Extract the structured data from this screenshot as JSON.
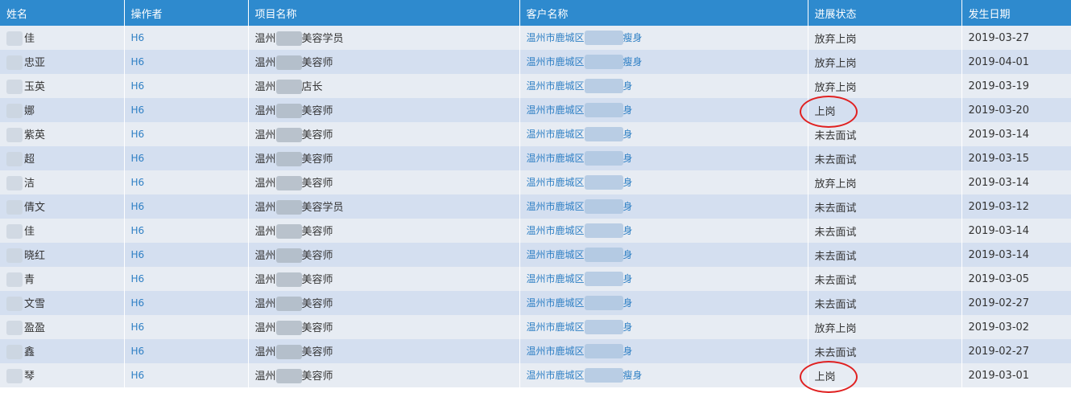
{
  "columns": [
    "姓名",
    "操作者",
    "项目名称",
    "客户名称",
    "进展状态",
    "发生日期"
  ],
  "rows": [
    {
      "name": "佳",
      "operator": "H6",
      "project_prefix": "温州",
      "project_suffix": "美容学员",
      "customer_prefix": "温州市鹿城区",
      "customer_suffix": "瘦身",
      "status": "放弃上岗",
      "date": "2019-03-27"
    },
    {
      "name": "忠亚",
      "operator": "H6",
      "project_prefix": "温州",
      "project_suffix": "美容师",
      "customer_prefix": "温州市鹿城区",
      "customer_suffix": "瘦身",
      "status": "放弃上岗",
      "date": "2019-04-01"
    },
    {
      "name": "玉英",
      "operator": "H6",
      "project_prefix": "温州",
      "project_suffix": "店长",
      "customer_prefix": "温州市鹿城区",
      "customer_suffix": "身",
      "status": "放弃上岗",
      "date": "2019-03-19"
    },
    {
      "name": "娜",
      "operator": "H6",
      "project_prefix": "温州",
      "project_suffix": "美容师",
      "customer_prefix": "温州市鹿城区",
      "customer_suffix": "身",
      "status": "上岗",
      "date": "2019-03-20"
    },
    {
      "name": "紫英",
      "operator": "H6",
      "project_prefix": "温州",
      "project_suffix": "美容师",
      "customer_prefix": "温州市鹿城区",
      "customer_suffix": "身",
      "status": "未去面试",
      "date": "2019-03-14"
    },
    {
      "name": "超",
      "operator": "H6",
      "project_prefix": "温州",
      "project_suffix": "美容师",
      "customer_prefix": "温州市鹿城区",
      "customer_suffix": "身",
      "status": "未去面试",
      "date": "2019-03-15"
    },
    {
      "name": "洁",
      "operator": "H6",
      "project_prefix": "温州",
      "project_suffix": "美容师",
      "customer_prefix": "温州市鹿城区",
      "customer_suffix": "身",
      "status": "放弃上岗",
      "date": "2019-03-14"
    },
    {
      "name": "倩文",
      "operator": "H6",
      "project_prefix": "温州",
      "project_suffix": "美容学员",
      "customer_prefix": "温州市鹿城区",
      "customer_suffix": "身",
      "status": "未去面试",
      "date": "2019-03-12"
    },
    {
      "name": "佳",
      "operator": "H6",
      "project_prefix": "温州",
      "project_suffix": "美容师",
      "customer_prefix": "温州市鹿城区",
      "customer_suffix": "身",
      "status": "未去面试",
      "date": "2019-03-14"
    },
    {
      "name": "晓红",
      "operator": "H6",
      "project_prefix": "温州",
      "project_suffix": "美容师",
      "customer_prefix": "温州市鹿城区",
      "customer_suffix": "身",
      "status": "未去面试",
      "date": "2019-03-14"
    },
    {
      "name": "青",
      "operator": "H6",
      "project_prefix": "温州",
      "project_suffix": "美容师",
      "customer_prefix": "温州市鹿城区",
      "customer_suffix": "身",
      "status": "未去面试",
      "date": "2019-03-05"
    },
    {
      "name": "文雪",
      "operator": "H6",
      "project_prefix": "温州",
      "project_suffix": "美容师",
      "customer_prefix": "温州市鹿城区",
      "customer_suffix": "身",
      "status": "未去面试",
      "date": "2019-02-27"
    },
    {
      "name": "盈盈",
      "operator": "H6",
      "project_prefix": "温州",
      "project_suffix": "美容师",
      "customer_prefix": "温州市鹿城区",
      "customer_suffix": "身",
      "status": "放弃上岗",
      "date": "2019-03-02"
    },
    {
      "name": "鑫",
      "operator": "H6",
      "project_prefix": "温州",
      "project_suffix": "美容师",
      "customer_prefix": "温州市鹿城区",
      "customer_suffix": "身",
      "status": "未去面试",
      "date": "2019-02-27"
    },
    {
      "name": "琴",
      "operator": "H6",
      "project_prefix": "温州",
      "project_suffix": "美容师",
      "customer_prefix": "温州市鹿城区",
      "customer_suffix": "瘦身",
      "status": "上岗",
      "date": "2019-03-01"
    }
  ],
  "highlighted_statuses": [
    "上岗"
  ],
  "colors": {
    "header_bg": "#2e8ace",
    "row_odd": "#e7ecf3",
    "row_even": "#d4dff0",
    "link": "#2e7fc4",
    "annotation": "#e02020"
  }
}
